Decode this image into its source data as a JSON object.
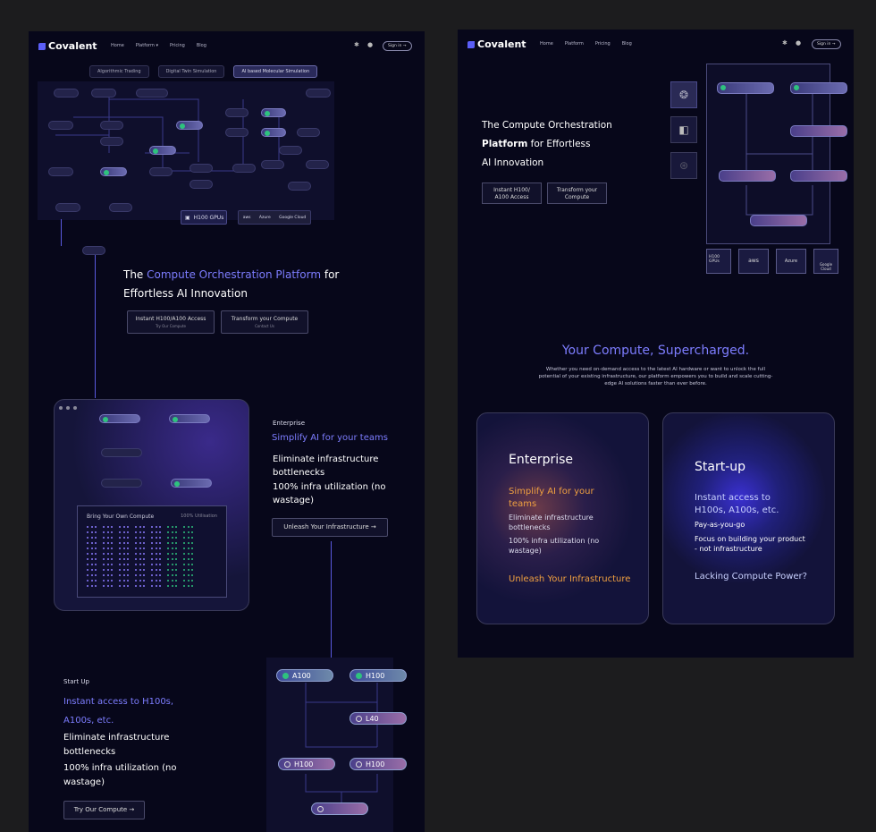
{
  "colors": {
    "bg": "#1c1c1e",
    "canvas": "#07071a",
    "accent": "#7d7dff",
    "orange": "#f0a040",
    "green": "#2ec27e"
  },
  "brand": "Covalent",
  "nav": {
    "home": "Home",
    "platform": "Platform",
    "platform_caret": "▾",
    "pricing": "Pricing",
    "blog": "Blog",
    "signin": "Sign in →"
  },
  "a": {
    "tabs": [
      "Algorithmic Trading",
      "Digital Twin Simulation",
      "AI based Molecular Simulation"
    ],
    "gpu_label": "H100 GPUs",
    "providers": [
      "aws",
      "Azure",
      "Google Cloud"
    ],
    "hero_pre": "The ",
    "hero_accent": "Compute Orchestration Platform",
    "hero_post": " for",
    "hero_line2": "Effortless AI Innovation",
    "cta1": "Instant H100/A100 Access",
    "cta1_sub": "Try Our Compute",
    "cta2": "Transform your Compute",
    "cta2_sub": "Contact Us",
    "panel_title": "Bring Your Own Compute",
    "panel_util": "100% Utilisation",
    "ent_label": "Enterprise",
    "ent_title": "Simplify AI for your teams",
    "ent_b1": "Eliminate infrastructure bottlenecks",
    "ent_b2": "100% infra utilization (no wastage)",
    "ent_cta": "Unleash Your Infrastructure →",
    "su_label": "Start Up",
    "su_title1": "Instant access to H100s,",
    "su_title2": "A100s, etc.",
    "su_b1": "Eliminate infrastructure bottlenecks",
    "su_b2": "100% infra utilization (no wastage)",
    "su_cta": "Try Our Compute →",
    "nodes": [
      "A100",
      "H100",
      "L40",
      "H100",
      "H100"
    ]
  },
  "b": {
    "hero_l1": "The Compute Orchestration",
    "hero_l2a": "Platform",
    "hero_l2b": " for Effortless",
    "hero_l3": "AI Innovation",
    "cta1": "Instant H100/ A100 Access",
    "cta2": "Transform your Compute",
    "chips": [
      "H100 GPUs",
      "aws",
      "Azure",
      "Google Cloud"
    ],
    "sec_title": "Your Compute, Supercharged.",
    "sec_body": "Whether you need on-demand access to the latest AI hardware or want to unlock the full potential of your existing infrastructure, our platform empowers you to build and scale cutting-edge AI solutions faster than ever before.",
    "ent_title": "Enterprise",
    "ent_sub": "Simplify AI for your teams",
    "ent_b1": "Eliminate infrastructure bottlenecks",
    "ent_b2": "100% infra utilization (no wastage)",
    "ent_cta": "Unleash Your Infrastructure",
    "su_title": "Start-up",
    "su_sub": "Instant access to H100s, A100s, etc.",
    "su_b1": "Pay-as-you-go",
    "su_b2": "Focus on building your product - not infrastructure",
    "su_cta": "Lacking Compute Power?"
  }
}
